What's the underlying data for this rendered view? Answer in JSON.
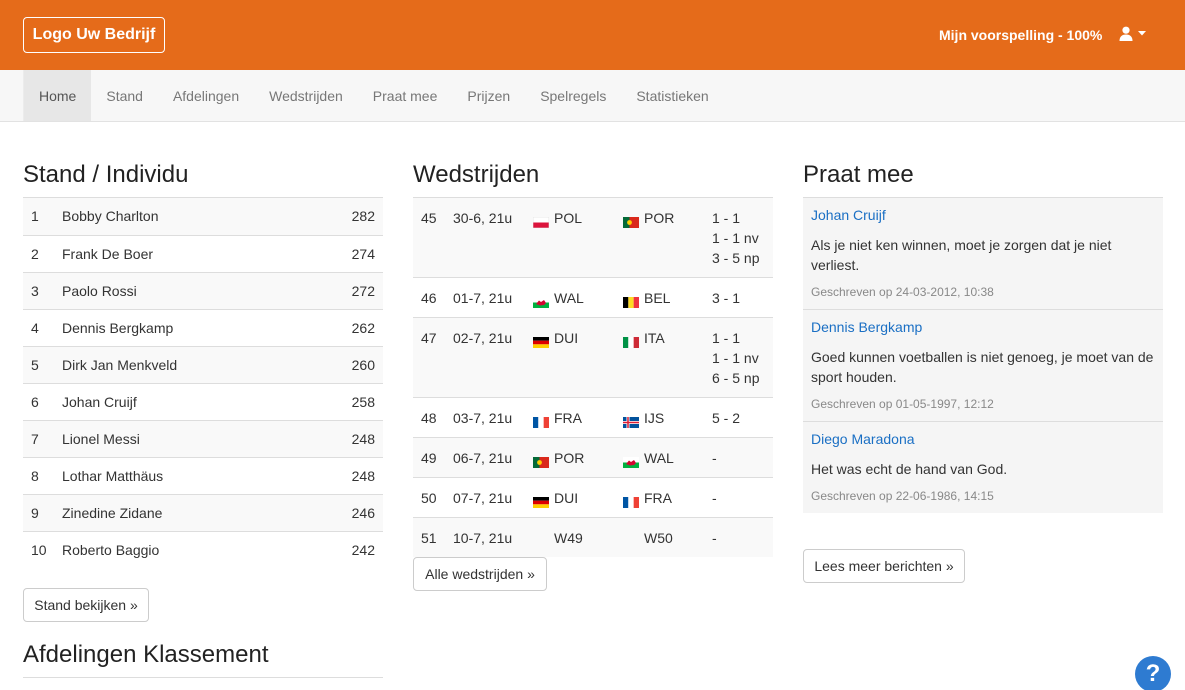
{
  "header": {
    "logo_label": "Logo Uw Bedrijf",
    "prediction_label": "Mijn voorspelling - 100%",
    "brand_color": "#e56b1a"
  },
  "nav": {
    "items": [
      {
        "label": "Home",
        "active": true
      },
      {
        "label": "Stand"
      },
      {
        "label": "Afdelingen"
      },
      {
        "label": "Wedstrijden"
      },
      {
        "label": "Praat mee"
      },
      {
        "label": "Prijzen"
      },
      {
        "label": "Spelregels"
      },
      {
        "label": "Statistieken"
      }
    ]
  },
  "stand": {
    "title": "Stand / Individu",
    "rows": [
      {
        "rank": "1",
        "name": "Bobby Charlton",
        "points": "282"
      },
      {
        "rank": "2",
        "name": "Frank De Boer",
        "points": "274"
      },
      {
        "rank": "3",
        "name": "Paolo Rossi",
        "points": "272"
      },
      {
        "rank": "4",
        "name": "Dennis Bergkamp",
        "points": "262"
      },
      {
        "rank": "5",
        "name": "Dirk Jan Menkveld",
        "points": "260"
      },
      {
        "rank": "6",
        "name": "Johan Cruijf",
        "points": "258"
      },
      {
        "rank": "7",
        "name": "Lionel Messi",
        "points": "248"
      },
      {
        "rank": "8",
        "name": "Lothar Matthäus",
        "points": "248"
      },
      {
        "rank": "9",
        "name": "Zinedine Zidane",
        "points": "246"
      },
      {
        "rank": "10",
        "name": "Roberto Baggio",
        "points": "242"
      }
    ],
    "button_label": "Stand bekijken »"
  },
  "departments": {
    "title": "Afdelingen Klassement"
  },
  "matches": {
    "title": "Wedstrijden",
    "rows": [
      {
        "num": "45",
        "date": "30-6, 21u",
        "home": "POL",
        "home_flag": "pol",
        "away": "POR",
        "away_flag": "por",
        "results": [
          "1 - 1",
          "1 - 1 nv",
          "3 - 5 np"
        ]
      },
      {
        "num": "46",
        "date": "01-7, 21u",
        "home": "WAL",
        "home_flag": "wal",
        "away": "BEL",
        "away_flag": "bel",
        "results": [
          "3 - 1"
        ]
      },
      {
        "num": "47",
        "date": "02-7, 21u",
        "home": "DUI",
        "home_flag": "dui",
        "away": "ITA",
        "away_flag": "ita",
        "results": [
          "1 - 1",
          "1 - 1 nv",
          "6 - 5 np"
        ]
      },
      {
        "num": "48",
        "date": "03-7, 21u",
        "home": "FRA",
        "home_flag": "fra",
        "away": "IJS",
        "away_flag": "ijs",
        "results": [
          "5 - 2"
        ]
      },
      {
        "num": "49",
        "date": "06-7, 21u",
        "home": "POR",
        "home_flag": "por",
        "away": "WAL",
        "away_flag": "wal",
        "results": [
          "-"
        ]
      },
      {
        "num": "50",
        "date": "07-7, 21u",
        "home": "DUI",
        "home_flag": "dui",
        "away": "FRA",
        "away_flag": "fra",
        "results": [
          "-"
        ]
      },
      {
        "num": "51",
        "date": "10-7, 21u",
        "home": "W49",
        "home_flag": "",
        "away": "W50",
        "away_flag": "",
        "results": [
          "-"
        ]
      }
    ],
    "button_label": "Alle wedstrijden »"
  },
  "chat": {
    "title": "Praat mee",
    "posts": [
      {
        "author": "Johan Cruijf",
        "text": "Als je niet ken winnen, moet je zorgen dat je niet verliest.",
        "meta": "Geschreven op 24-03-2012, 10:38"
      },
      {
        "author": "Dennis Bergkamp",
        "text": "Goed kunnen voetballen is niet genoeg, je moet van de sport houden.",
        "meta": "Geschreven op 01-05-1997, 12:12"
      },
      {
        "author": "Diego Maradona",
        "text": "Het was echt de hand van God.",
        "meta": "Geschreven op 22-06-1986, 14:15"
      }
    ],
    "button_label": "Lees meer berichten »"
  },
  "help": {
    "label": "?"
  }
}
